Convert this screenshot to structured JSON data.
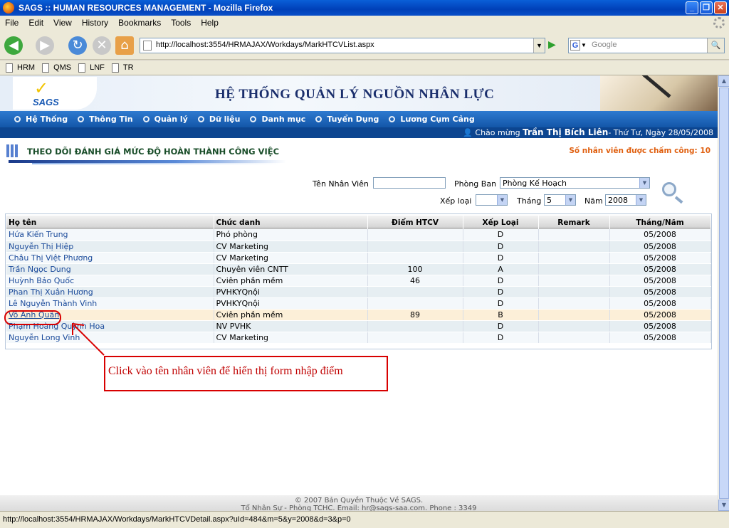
{
  "window": {
    "title": "SAGS :: HUMAN RESOURCES MANAGEMENT - Mozilla Firefox"
  },
  "menubar": [
    "File",
    "Edit",
    "View",
    "History",
    "Bookmarks",
    "Tools",
    "Help"
  ],
  "nav": {
    "url": "http://localhost:3554/HRMAJAX/Workdays/MarkHTCVList.aspx",
    "search_placeholder": "Google"
  },
  "bookmarks": [
    "HRM",
    "QMS",
    "LNF",
    "TR"
  ],
  "banner": {
    "logo": "SAGS",
    "title": "HỆ THỐNG QUẢN LÝ NGUỒN NHÂN LỰC"
  },
  "appmenu": [
    "Hệ Thống",
    "Thông Tin",
    "Quản lý",
    "Dữ liệu",
    "Danh mục",
    "Tuyển Dụng",
    "Lương Cụm Cảng"
  ],
  "welcome": {
    "prefix": "Chào mừng ",
    "user": "Trần Thị Bích Liên",
    "suffix": "- Thứ Tư, Ngày 28/05/2008"
  },
  "page": {
    "title": "THEO DÕI ĐÁNH GIÁ MỨC ĐỘ HOÀN THÀNH CÔNG VIỆC",
    "count_label": "Số nhân viên được chấm công: 10"
  },
  "filters": {
    "name_label": "Tên Nhân Viên",
    "name_value": "",
    "dept_label": "Phòng Ban",
    "dept_value": "Phòng Kế Hoạch",
    "rank_label": "Xếp loại",
    "rank_value": "",
    "month_label": "Tháng",
    "month_value": "5",
    "year_label": "Năm",
    "year_value": "2008"
  },
  "table": {
    "headers": [
      "Họ tên",
      "Chức danh",
      "Điểm HTCV",
      "Xếp Loại",
      "Remark",
      "Tháng/Năm"
    ],
    "rows": [
      [
        "Hứa Kiến Trung",
        "Phó phòng",
        "",
        "D",
        "",
        "05/2008"
      ],
      [
        "Nguyễn Thị Hiệp",
        "CV Marketing",
        "",
        "D",
        "",
        "05/2008"
      ],
      [
        "Châu Thị Việt Phương",
        "CV Marketing",
        "",
        "D",
        "",
        "05/2008"
      ],
      [
        "Trần Ngọc Dung",
        "Chuyên viên CNTT",
        "100",
        "A",
        "",
        "05/2008"
      ],
      [
        "Huỳnh Bảo Quốc",
        "Cviên phần mềm",
        "46",
        "D",
        "",
        "05/2008"
      ],
      [
        "Phan Thị Xuân Hương",
        "PVHKYQnội",
        "",
        "D",
        "",
        "05/2008"
      ],
      [
        "Lê Nguyễn Thành Vinh",
        "PVHKYQnội",
        "",
        "D",
        "",
        "05/2008"
      ],
      [
        "Võ Anh Quân",
        "Cviên phần mềm",
        "89",
        "B",
        "",
        "05/2008"
      ],
      [
        "Phạm Hoàng Quỳnh Hoa",
        "NV PVHK",
        "",
        "D",
        "",
        "05/2008"
      ],
      [
        "Nguyễn Long Vinh",
        "CV Marketing",
        "",
        "D",
        "",
        "05/2008"
      ]
    ]
  },
  "annotation": "Click vào tên nhân viên để hiển thị form nhập điểm",
  "footer": {
    "line1": "© 2007 Bản Quyền Thuộc Về SAGS.",
    "line2": "Tổ Nhân Sự - Phòng TCHC. Email: hr@sags-saa.com. Phone : 3349"
  },
  "status": "http://localhost:3554/HRMAJAX/Workdays/MarkHTCVDetail.aspx?uId=484&m=5&y=2008&d=3&p=0",
  "colors": {
    "app_menu": "#1356a8",
    "accent_orange": "#e06010",
    "annotation_red": "#d80000"
  }
}
